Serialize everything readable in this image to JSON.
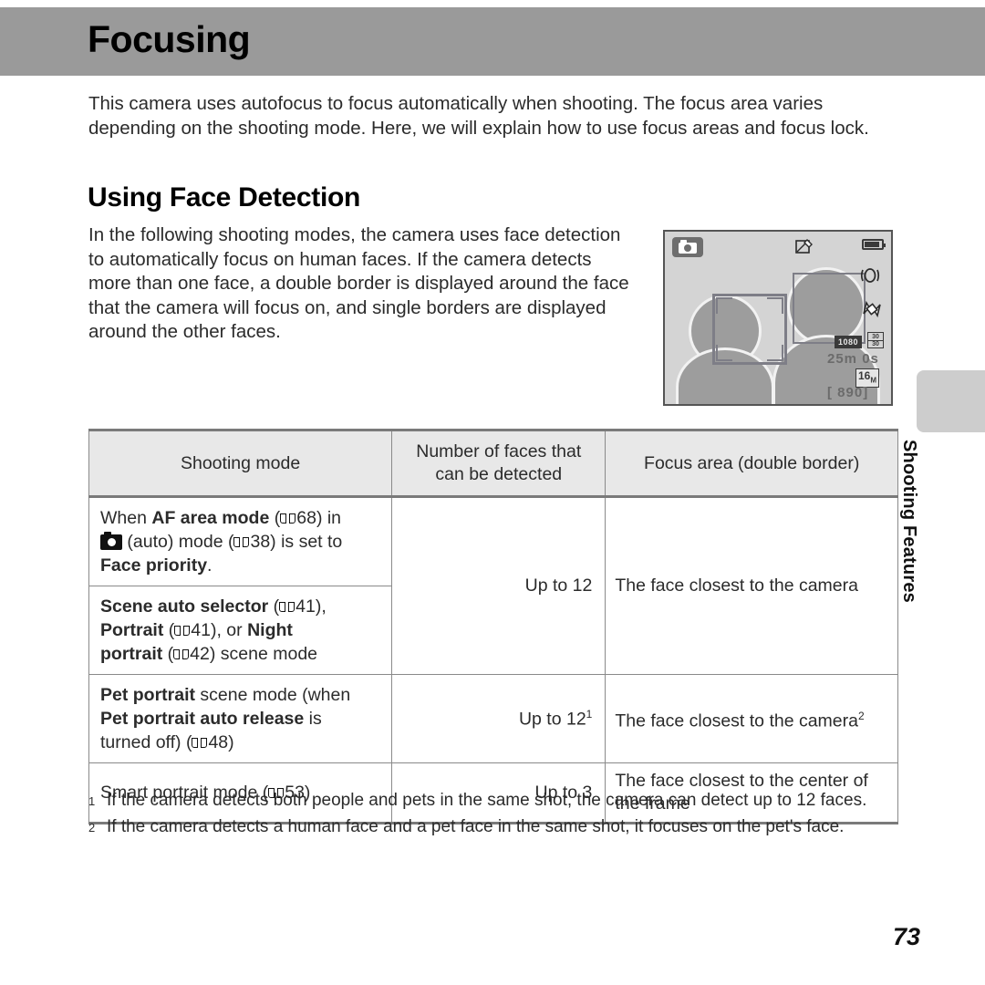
{
  "header": {
    "title": "Focusing",
    "band_color": "#9a9a9a"
  },
  "intro": {
    "text": "This camera uses autofocus to focus automatically when shooting. The focus area varies depending on the shooting mode. Here, we will explain how to use focus areas and focus lock."
  },
  "section": {
    "heading": "Using Face Detection",
    "paragraph": "In the following shooting modes, the camera uses face detection to automatically focus on human faces. If the camera detects more than one face, a double border is displayed around the face that the camera will focus on, and single borders are displayed around the other faces."
  },
  "lcd": {
    "mode_icon": "camera-auto-icon",
    "top_center_icon": "retouch-icon",
    "battery_icon": "battery-full-icon",
    "vr_icon": "vibration-reduction-icon",
    "pet_icon": "bowtie-icon",
    "movie_size": "1080",
    "frame_rate": "30",
    "record_time": "25m 0s",
    "image_size": "16",
    "image_size_unit": "M",
    "shots_remaining": "[ 890]",
    "focus_border_double": "double-border-left-face",
    "focus_border_single": "single-border-right-face"
  },
  "table": {
    "headers": {
      "shooting_mode": "Shooting mode",
      "number_of_faces_line1": "Number of faces that",
      "number_of_faces_line2": "can be detected",
      "focus_area": "Focus area (double border)"
    },
    "rows": [
      {
        "mode_parts": [
          {
            "t": "When ",
            "b": false
          },
          {
            "t": "AF area mode",
            "b": true
          },
          {
            "t": " (",
            "b": false
          },
          {
            "t": "BOOK",
            "b": false,
            "icon": "book"
          },
          {
            "t": "68) in",
            "b": false
          },
          {
            "t": "BR",
            "b": false,
            "br": true
          },
          {
            "t": "CAM",
            "b": false,
            "icon": "camera"
          },
          {
            "t": " (auto) mode (",
            "b": false
          },
          {
            "t": "BOOK",
            "b": false,
            "icon": "book"
          },
          {
            "t": "38) is set to",
            "b": false
          },
          {
            "t": "BR",
            "b": false,
            "br": true
          },
          {
            "t": "Face priority",
            "b": true
          },
          {
            "t": ".",
            "b": false
          }
        ],
        "count": "Up to 12",
        "count_sup": "",
        "count_rowspan": 2,
        "area": "The face closest to the camera",
        "area_sup": "",
        "area_rowspan": 2
      },
      {
        "mode_parts": [
          {
            "t": "Scene auto selector",
            "b": true
          },
          {
            "t": " (",
            "b": false
          },
          {
            "t": "BOOK",
            "b": false,
            "icon": "book"
          },
          {
            "t": "41),",
            "b": false
          },
          {
            "t": "BR",
            "b": false,
            "br": true
          },
          {
            "t": "Portrait",
            "b": true
          },
          {
            "t": " (",
            "b": false
          },
          {
            "t": "BOOK",
            "b": false,
            "icon": "book"
          },
          {
            "t": "41), or ",
            "b": false
          },
          {
            "t": "Night",
            "b": true
          },
          {
            "t": "BR",
            "b": false,
            "br": true
          },
          {
            "t": "portrait",
            "b": true
          },
          {
            "t": " (",
            "b": false
          },
          {
            "t": "BOOK",
            "b": false,
            "icon": "book"
          },
          {
            "t": "42) scene mode",
            "b": false
          }
        ],
        "count": null,
        "area": null
      },
      {
        "mode_parts": [
          {
            "t": "Pet portrait",
            "b": true
          },
          {
            "t": " scene mode (when",
            "b": false
          },
          {
            "t": "BR",
            "b": false,
            "br": true
          },
          {
            "t": "Pet portrait auto release",
            "b": true
          },
          {
            "t": " is",
            "b": false
          },
          {
            "t": "BR",
            "b": false,
            "br": true
          },
          {
            "t": "turned off) (",
            "b": false
          },
          {
            "t": "BOOK",
            "b": false,
            "icon": "book"
          },
          {
            "t": "48)",
            "b": false
          }
        ],
        "count": "Up to 12",
        "count_sup": "1",
        "count_rowspan": 1,
        "area": "The face closest to the camera",
        "area_sup": "2",
        "area_rowspan": 1
      },
      {
        "mode_parts": [
          {
            "t": "Smart portrait mode (",
            "b": false
          },
          {
            "t": "BOOK",
            "b": false,
            "icon": "book"
          },
          {
            "t": "53)",
            "b": false
          }
        ],
        "count": "Up to 3",
        "count_sup": "",
        "count_rowspan": 1,
        "area": "The face closest to the center of the frame",
        "area_sup": "",
        "area_rowspan": 1
      }
    ]
  },
  "footnotes": [
    {
      "num": "1",
      "text": "If the camera detects both people and pets in the same shot, the camera can detect up to 12 faces."
    },
    {
      "num": "2",
      "text": "If the camera detects a human face and a pet face in the same shot, it focuses on the pet's face."
    }
  ],
  "side_tab": {
    "label": "Shooting Features",
    "color": "#cdcdcd"
  },
  "page_number": "73"
}
